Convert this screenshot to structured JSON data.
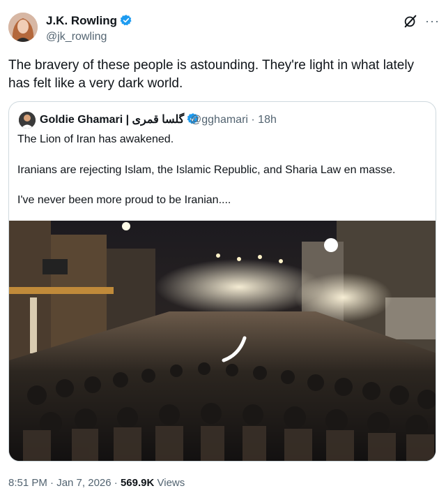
{
  "author": {
    "name": "J.K. Rowling",
    "handle": "@jk_rowling"
  },
  "tweet": {
    "text": "The bravery of these people is astounding. They're light in what lately\nhas felt like a very dark world."
  },
  "quoted": {
    "name": "Goldie Ghamari | گلسا قمری",
    "handle": "@gghamari",
    "time": "· 18h",
    "lines": [
      "The Lion of Iran has awakened.",
      "Iranians are rejecting Islam, the Islamic Republic, and Sharia Law en masse.",
      "I've never been more proud to be Iranian...."
    ]
  },
  "footer": {
    "time": "8:51 PM",
    "date": "· Jan 7, 2026 ·",
    "views_count": "569.9K",
    "views_label": "Views"
  },
  "icons": {
    "more": "more-icon",
    "grok": "grok-icon",
    "verified": "verified-badge-icon"
  },
  "colors": {
    "verified_blue": "#1d9bf0",
    "secondary_text": "#536471",
    "border": "#cfd9de"
  }
}
